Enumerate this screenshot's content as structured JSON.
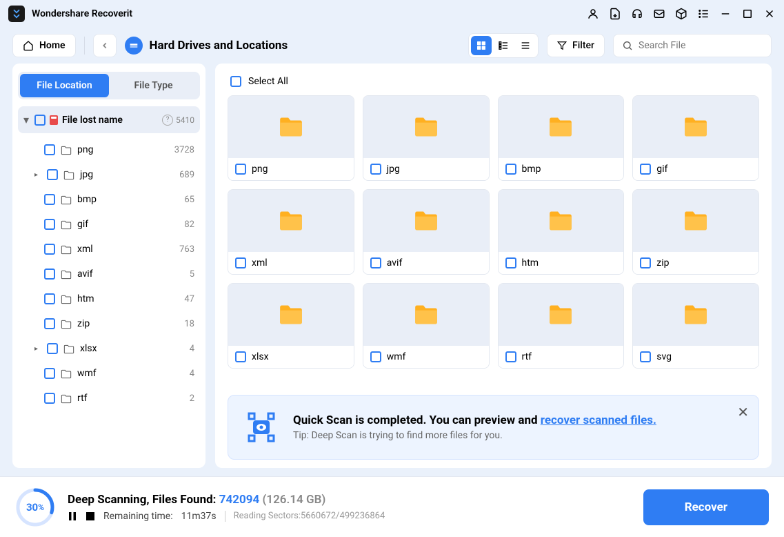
{
  "app_title": "Wondershare Recoverit",
  "toolbar": {
    "home_label": "Home",
    "location_title": "Hard Drives and Locations",
    "filter_label": "Filter",
    "search_placeholder": "Search File"
  },
  "sidebar": {
    "tabs": {
      "location": "File Location",
      "type": "File Type"
    },
    "root": {
      "label": "File lost name",
      "count": "5410"
    },
    "items": [
      {
        "name": "png",
        "count": "3728",
        "caret": false
      },
      {
        "name": "jpg",
        "count": "689",
        "caret": true
      },
      {
        "name": "bmp",
        "count": "65",
        "caret": false
      },
      {
        "name": "gif",
        "count": "82",
        "caret": false
      },
      {
        "name": "xml",
        "count": "763",
        "caret": false
      },
      {
        "name": "avif",
        "count": "5",
        "caret": false
      },
      {
        "name": "htm",
        "count": "47",
        "caret": false
      },
      {
        "name": "zip",
        "count": "18",
        "caret": false
      },
      {
        "name": "xlsx",
        "count": "4",
        "caret": true
      },
      {
        "name": "wmf",
        "count": "4",
        "caret": false
      },
      {
        "name": "rtf",
        "count": "2",
        "caret": false
      }
    ]
  },
  "content": {
    "select_all": "Select All",
    "folders": [
      "png",
      "jpg",
      "bmp",
      "gif",
      "xml",
      "avif",
      "htm",
      "zip",
      "xlsx",
      "wmf",
      "rtf",
      "svg"
    ]
  },
  "notification": {
    "title_prefix": "Quick Scan is completed. You can preview and ",
    "title_link": "recover scanned files.",
    "tip": "Tip: Deep Scan is trying to find more files for you."
  },
  "footer": {
    "progress_percent": "30",
    "scan_label": "Deep Scanning, Files Found: ",
    "files_found": "742094",
    "size": "(126.14 GB)",
    "remaining_label": "Remaining time:",
    "remaining_value": "11m37s",
    "sectors": "Reading Sectors:5660672/499236864",
    "recover_label": "Recover"
  }
}
